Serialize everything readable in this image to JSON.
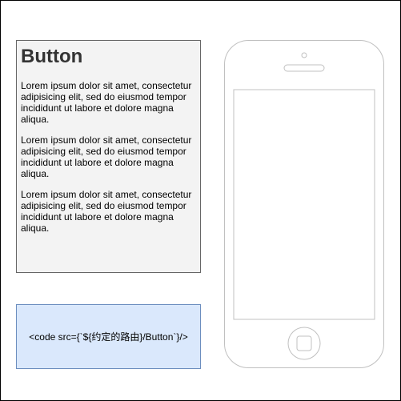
{
  "doc_card": {
    "title": "Button",
    "paragraphs": [
      "Lorem ipsum dolor sit amet, consectetur adipisicing elit, sed do eiusmod tempor incididunt ut labore et dolore magna aliqua.",
      "Lorem ipsum dolor sit amet, consectetur adipisicing elit, sed do eiusmod tempor incididunt ut labore et dolore magna aliqua.",
      "Lorem ipsum dolor sit amet, consectetur adipisicing elit, sed do eiusmod tempor incididunt ut labore et dolore magna aliqua."
    ]
  },
  "code_box": {
    "text": "<code src={`${约定的路由}/Button`}/>"
  },
  "colors": {
    "doc_fill": "#f3f3f3",
    "doc_stroke": "#666666",
    "code_fill": "#dae8fc",
    "code_stroke": "#6c8ebf",
    "phone_stroke": "#c0c0c0"
  },
  "icons": {
    "device": "iphone-mockup-icon",
    "home_button": "home-button-icon",
    "speaker": "speaker-grille-icon",
    "camera": "front-camera-icon"
  }
}
